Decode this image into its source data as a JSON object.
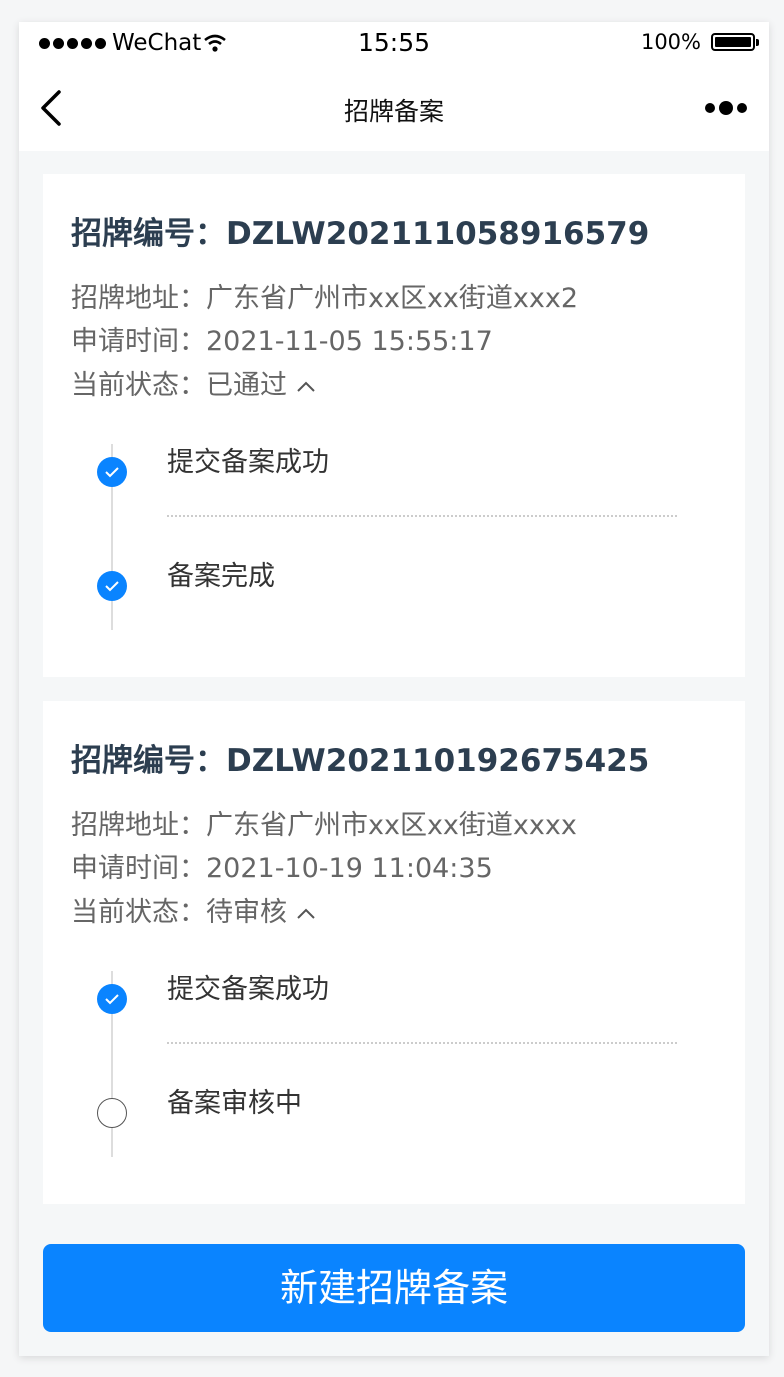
{
  "status_bar": {
    "carrier": "WeChat",
    "time": "15:55",
    "battery": "100%"
  },
  "nav": {
    "title": "招牌备案"
  },
  "records": [
    {
      "title": "招牌编号：DZLW202111058916579",
      "address": "招牌地址：广东省广州市xx区xx街道xxx2",
      "time": "申请时间：2021-11-05 15:55:17",
      "status": "当前状态：已通过",
      "steps": [
        {
          "label": "提交备案成功",
          "state": "done"
        },
        {
          "label": "备案完成",
          "state": "done"
        }
      ]
    },
    {
      "title": "招牌编号：DZLW202110192675425",
      "address": "招牌地址：广东省广州市xx区xx街道xxxx",
      "time": "申请时间：2021-10-19 11:04:35",
      "status": "当前状态：待审核",
      "steps": [
        {
          "label": "提交备案成功",
          "state": "done"
        },
        {
          "label": "备案审核中",
          "state": "pending"
        }
      ]
    }
  ],
  "new_button": "新建招牌备案",
  "colors": {
    "accent": "#0a84ff",
    "title": "#2c3e50"
  }
}
